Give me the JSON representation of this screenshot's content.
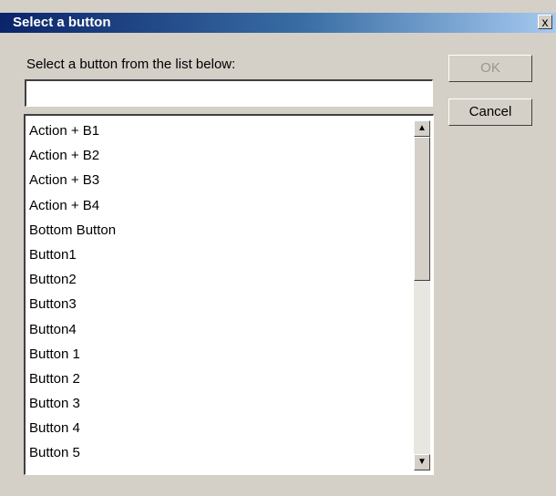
{
  "dialog": {
    "title": "Select a button",
    "close_label": "x",
    "prompt": "Select a button from the list below:",
    "filter_value": "",
    "ok_label": "OK",
    "cancel_label": "Cancel",
    "list_items": [
      "Action + B1",
      "Action + B2",
      "Action + B3",
      "Action + B4",
      "Bottom Button",
      "Button1",
      "Button2",
      "Button3",
      "Button4",
      "Button 1",
      "Button 2",
      "Button 3",
      "Button 4",
      "Button 5"
    ],
    "scrollbar": {
      "up_icon": "▲",
      "down_icon": "▼"
    }
  }
}
